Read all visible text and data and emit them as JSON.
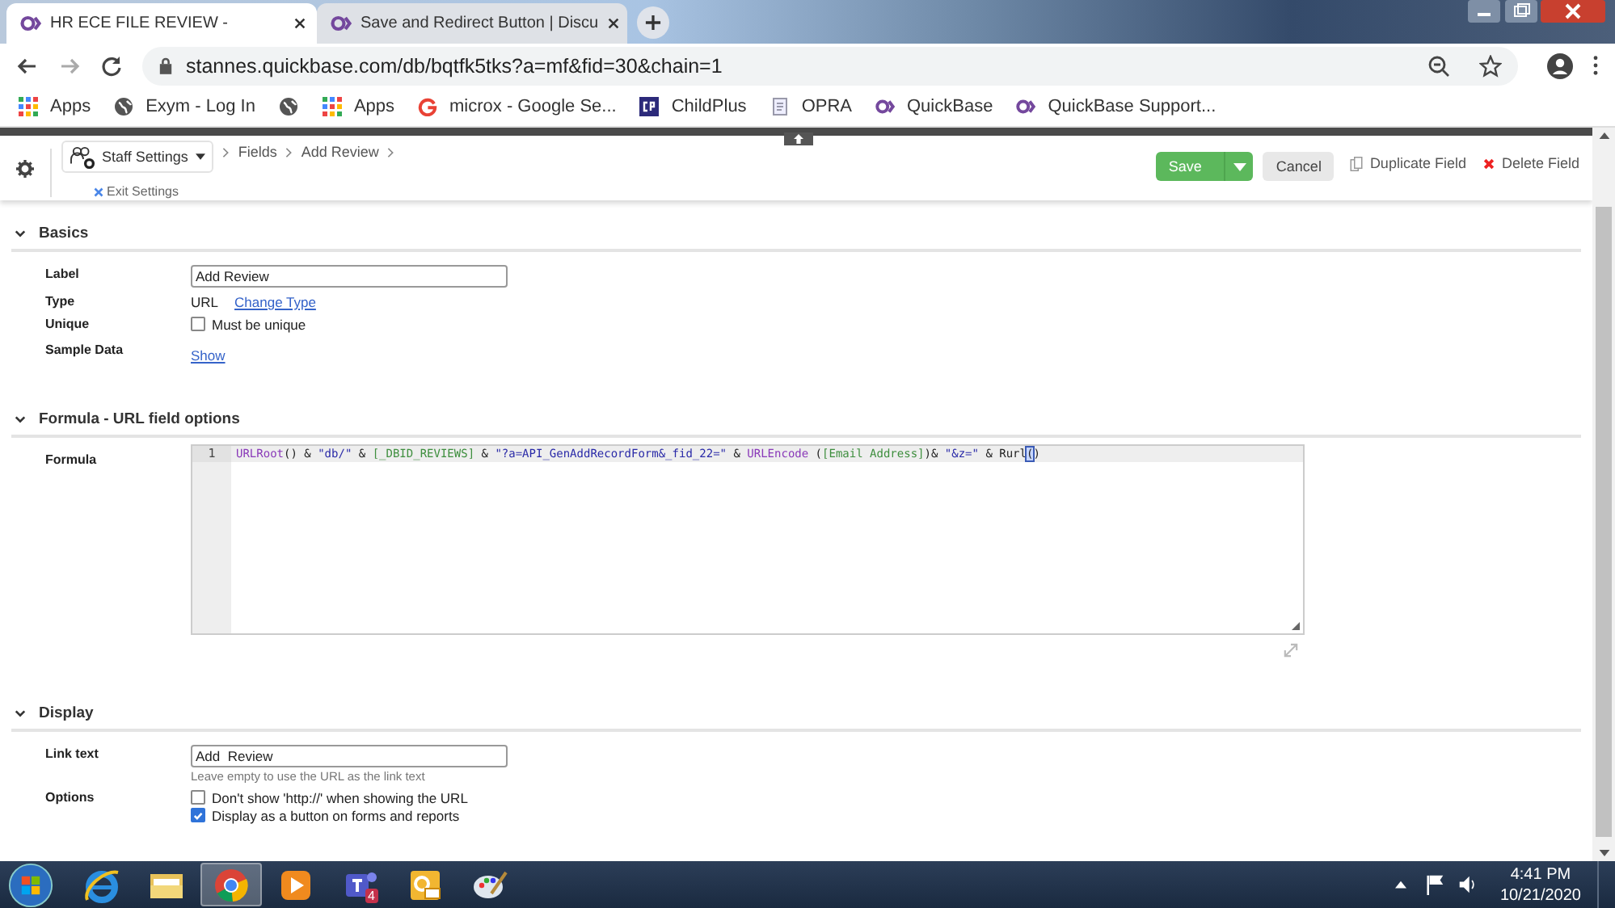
{
  "browser": {
    "tabs": [
      {
        "title": "HR ECE FILE REVIEW -",
        "selected": true
      },
      {
        "title": "Save and Redirect Button | Discu",
        "selected": false
      }
    ],
    "address": "stannes.quickbase.com/db/bqtfk5tks?a=mf&fid=30&chain=1",
    "bookmarks": [
      {
        "kind": "apps",
        "label": "Apps"
      },
      {
        "kind": "globe",
        "label": "Exym - Log In"
      },
      {
        "kind": "globe"
      },
      {
        "kind": "apps",
        "label": "Apps"
      },
      {
        "kind": "google",
        "label": "microx - Google Se..."
      },
      {
        "kind": "cp",
        "label": "ChildPlus"
      },
      {
        "kind": "doc",
        "label": "OPRA"
      },
      {
        "kind": "qb",
        "label": "QuickBase"
      },
      {
        "kind": "qb",
        "label": "QuickBase Support..."
      }
    ]
  },
  "toolbar": {
    "app_menu": "Staff Settings",
    "breadcrumb": [
      "Fields",
      "Add Review"
    ],
    "exit": "Exit Settings",
    "save": "Save",
    "cancel": "Cancel",
    "duplicate": "Duplicate Field",
    "delete": "Delete Field"
  },
  "sections": [
    {
      "title": "Basics",
      "expanded": true,
      "rows": [
        {
          "label": "Label",
          "kind": "input",
          "value": "Add Review"
        },
        {
          "label": "Type",
          "kind": "type",
          "value": "URL",
          "link": "Change Type"
        },
        {
          "label": "Unique",
          "kind": "checks",
          "options": [
            {
              "text": "Must be unique",
              "checked": false
            }
          ]
        },
        {
          "label": "Sample Data",
          "kind": "link",
          "link": "Show"
        }
      ]
    },
    {
      "title": "Formula - URL field options",
      "expanded": true,
      "rows": [
        {
          "label": "Formula",
          "kind": "formula",
          "lines": [
            {
              "number": "1",
              "tokens": [
                {
                  "kind": "func",
                  "text": "URLRoot"
                },
                {
                  "kind": "op",
                  "text": "() & "
                },
                {
                  "kind": "str",
                  "text": "\"db/\""
                },
                {
                  "kind": "op",
                  "text": " & "
                },
                {
                  "kind": "field",
                  "text": "[_DBID_REVIEWS]"
                },
                {
                  "kind": "op",
                  "text": " & "
                },
                {
                  "kind": "str",
                  "text": "\"?a=API_GenAddRecordForm&_fid_22=\""
                },
                {
                  "kind": "op",
                  "text": " & "
                },
                {
                  "kind": "func",
                  "text": "URLEncode"
                },
                {
                  "kind": "op",
                  "text": " ("
                },
                {
                  "kind": "field",
                  "text": "[Email Address]"
                },
                {
                  "kind": "op",
                  "text": ")& "
                },
                {
                  "kind": "str",
                  "text": "\"&z=\""
                },
                {
                  "kind": "op",
                  "text": " & Rurl"
                },
                {
                  "kind": "match",
                  "text": "("
                },
                {
                  "kind": "op",
                  "text": ")"
                }
              ]
            }
          ]
        }
      ]
    },
    {
      "title": "Display",
      "expanded": true,
      "rows": [
        {
          "label": "Link text",
          "kind": "input",
          "value": "Add  Review",
          "hint": "Leave empty to use the URL as the link text"
        },
        {
          "label": "Options",
          "kind": "checks",
          "options": [
            {
              "text": "Don't show 'http://' when showing the URL",
              "checked": false
            },
            {
              "text": "Display as a button on forms and reports",
              "checked": true
            }
          ]
        }
      ]
    }
  ],
  "taskbar": {
    "apps": [
      {
        "kind": "ie",
        "selected": false
      },
      {
        "kind": "folder",
        "selected": false
      },
      {
        "kind": "chrome",
        "selected": true
      },
      {
        "kind": "player",
        "selected": false
      },
      {
        "kind": "teams",
        "selected": false,
        "badge": "4"
      },
      {
        "kind": "outlook",
        "selected": false
      },
      {
        "kind": "paint",
        "selected": false
      }
    ],
    "time": "4:41 PM",
    "date": "10/21/2020"
  }
}
